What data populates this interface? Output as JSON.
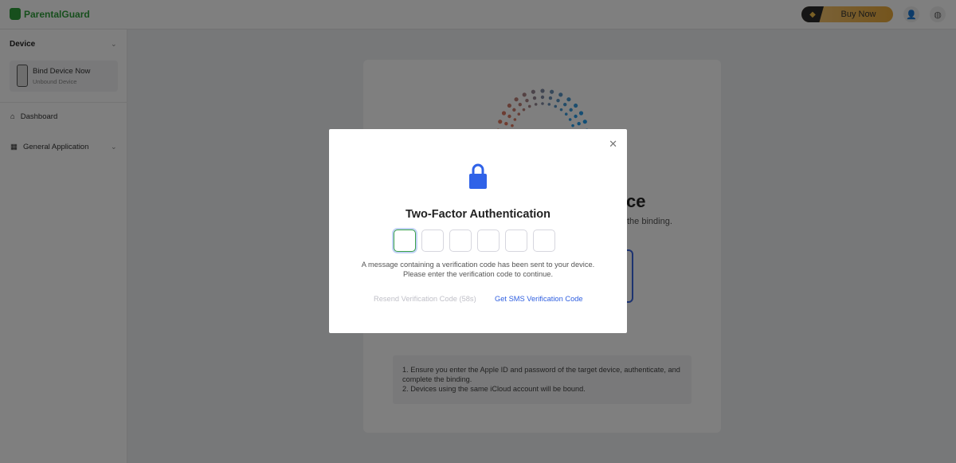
{
  "app": {
    "name": "ParentalGuard",
    "brand_color": "#2e9e3a"
  },
  "topbar": {
    "buy_label": "Buy Now",
    "icons": [
      "diamond-icon",
      "user-icon",
      "globe-icon"
    ]
  },
  "sidebar": {
    "section_title": "Device",
    "device": {
      "name": "Bind Device Now",
      "status": "Unbound Device"
    },
    "items": [
      {
        "label": "Dashboard",
        "icon": "home-icon"
      },
      {
        "label": "General Application",
        "icon": "apps-icon"
      }
    ]
  },
  "main": {
    "title_fragment": "ce",
    "subtitle_fragment": "the binding.",
    "notes": [
      "1. Ensure you enter the Apple ID and password of the target device, authenticate, and complete the binding.",
      "2. Devices using the same iCloud account will be bound."
    ]
  },
  "modal": {
    "title": "Two-Factor Authentication",
    "code_length": 6,
    "message_line1": "A message containing a verification code has been sent to your device.",
    "message_line2": "Please enter the verification code to continue.",
    "resend_label": "Resend Verification Code (58s)",
    "sms_label": "Get SMS Verification Code",
    "accent_color": "#2f5fe0"
  }
}
